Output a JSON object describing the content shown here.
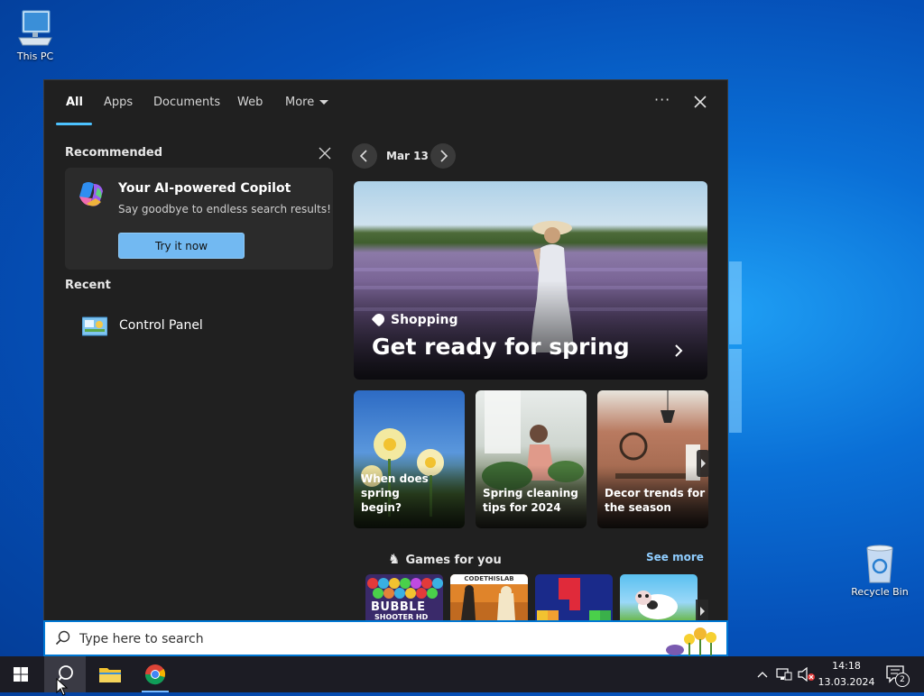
{
  "desktop": {
    "this_pc": "This PC",
    "recycle_bin": "Recycle Bin"
  },
  "tabs": [
    {
      "label": "All",
      "active": true
    },
    {
      "label": "Apps"
    },
    {
      "label": "Documents"
    },
    {
      "label": "Web"
    },
    {
      "label": "More"
    }
  ],
  "topbar": {
    "options": "···"
  },
  "recommended": {
    "title": "Recommended",
    "copilot_title": "Your AI-powered Copilot",
    "copilot_sub": "Say goodbye to endless search results!",
    "button": "Try it now"
  },
  "recent": {
    "title": "Recent",
    "items": [
      {
        "label": "Control Panel",
        "icon": "control-panel-icon"
      }
    ]
  },
  "feed": {
    "date": "Mar 13",
    "hero_tag": "Shopping",
    "hero_title": "Get ready for spring",
    "cards": [
      {
        "caption_line1": "When does spring",
        "caption_line2": "begin?"
      },
      {
        "caption_line1": "Spring cleaning",
        "caption_line2": "tips for 2024"
      },
      {
        "caption_line1": "Decor trends for",
        "caption_line2": "the season"
      }
    ],
    "games_title": "Games for you",
    "see_more": "See more",
    "game1_line1": "BUBBLE",
    "game1_line2": "SHOOTER HD",
    "game2_label": "CODETHISLAB"
  },
  "search": {
    "placeholder": "Type here to search"
  },
  "tray": {
    "time": "14:18",
    "date": "13.03.2024",
    "notifications": "2"
  },
  "colors": {
    "accent": "#4cc2ff",
    "panel_bg": "#202020",
    "button": "#72b9f2"
  }
}
